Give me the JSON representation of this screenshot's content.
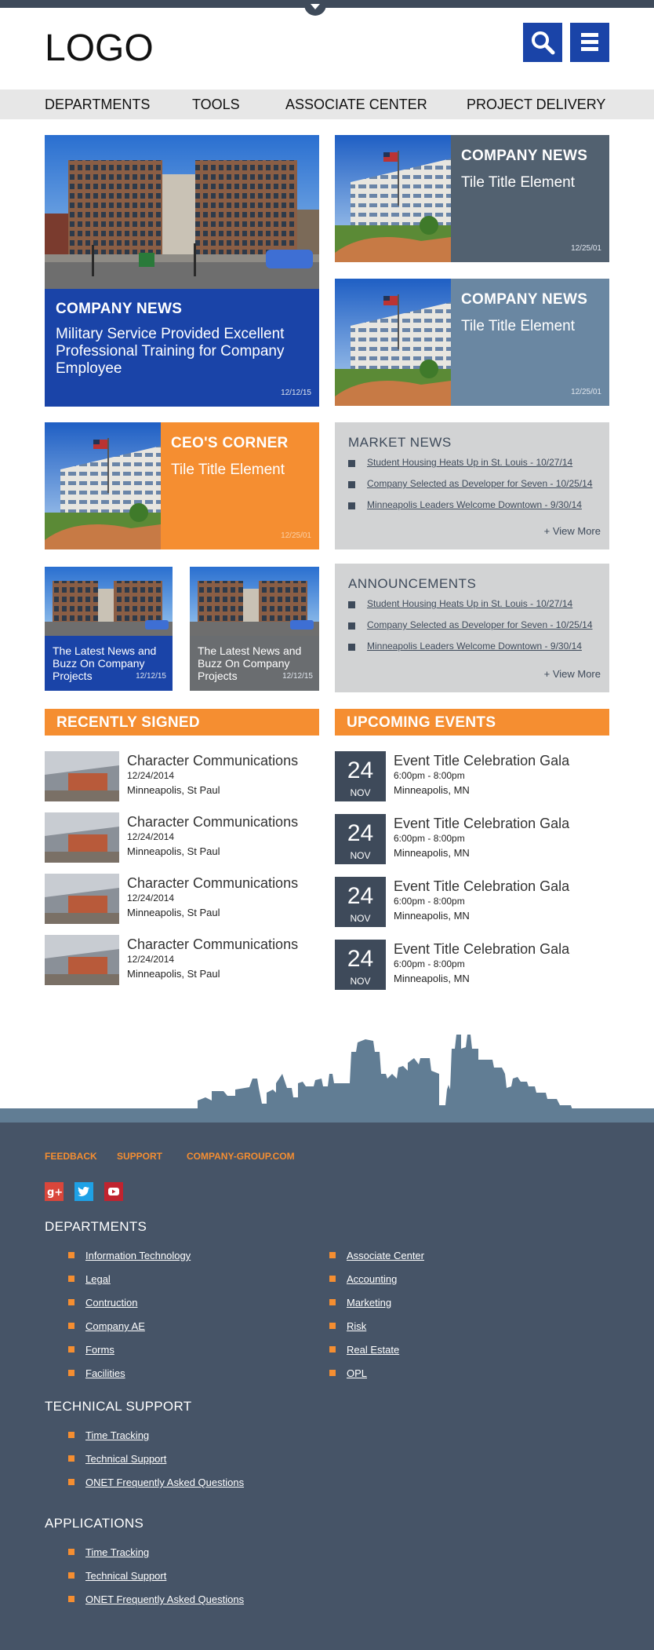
{
  "header": {
    "logo": "LOGO",
    "search_label": "Search",
    "menu_label": "Menu"
  },
  "nav": [
    "DEPARTMENTS",
    "TOOLS",
    "ASSOCIATE CENTER",
    "PROJECT DELIVERY"
  ],
  "hero": {
    "category": "COMPANY NEWS",
    "title": "Military Service Provided Excellent Professional Training for Company Employee",
    "date": "12/12/15"
  },
  "news_tiles": [
    {
      "category": "COMPANY NEWS",
      "title": "Tile Title Element",
      "date": "12/25/01"
    },
    {
      "category": "COMPANY NEWS",
      "title": "Tile Title Element",
      "date": "12/25/01"
    }
  ],
  "ceo_tile": {
    "category": "CEO'S CORNER",
    "title": "Tile Title Element",
    "date": "12/25/01"
  },
  "market_news": {
    "heading": "MARKET NEWS",
    "items": [
      "Student Housing Heats Up in St. Louis - 10/27/14",
      "Company Selected as Developer for Seven - 10/25/14",
      "Minneapolis Leaders Welcome Downtown - 9/30/14"
    ],
    "view_more": "+  View More"
  },
  "small_tiles": [
    {
      "title": "The Latest News and Buzz On Company Projects",
      "date": "12/12/15"
    },
    {
      "title": "The Latest News and Buzz On Company Projects",
      "date": "12/12/15"
    }
  ],
  "announcements": {
    "heading": "ANNOUNCEMENTS",
    "items": [
      "Student Housing Heats Up in St. Louis - 10/27/14",
      "Company Selected as Developer for Seven - 10/25/14",
      "Minneapolis Leaders Welcome Downtown - 9/30/14"
    ],
    "view_more": "+  View More"
  },
  "recently_signed": {
    "heading": "RECENTLY SIGNED",
    "items": [
      {
        "name": "Character Communications",
        "date": "12/24/2014",
        "location": "Minneapolis, St Paul"
      },
      {
        "name": "Character Communications",
        "date": "12/24/2014",
        "location": "Minneapolis, St Paul"
      },
      {
        "name": "Character Communications",
        "date": "12/24/2014",
        "location": "Minneapolis, St Paul"
      },
      {
        "name": "Character Communications",
        "date": "12/24/2014",
        "location": "Minneapolis, St Paul"
      }
    ]
  },
  "upcoming_events": {
    "heading": "UPCOMING EVENTS",
    "items": [
      {
        "day": "24",
        "month": "NOV",
        "title": "Event Title Celebration Gala",
        "time": "6:00pm - 8:00pm",
        "location": "Minneapolis, MN"
      },
      {
        "day": "24",
        "month": "NOV",
        "title": "Event Title Celebration Gala",
        "time": "6:00pm - 8:00pm",
        "location": "Minneapolis, MN"
      },
      {
        "day": "24",
        "month": "NOV",
        "title": "Event Title Celebration Gala",
        "time": "6:00pm - 8:00pm",
        "location": "Minneapolis, MN"
      },
      {
        "day": "24",
        "month": "NOV",
        "title": "Event Title Celebration Gala",
        "time": "6:00pm - 8:00pm",
        "location": "Minneapolis, MN"
      }
    ]
  },
  "footer": {
    "links": [
      "FEEDBACK",
      "SUPPORT",
      "COMPANY-GROUP.COM"
    ],
    "social": [
      "google-plus-icon",
      "twitter-icon",
      "youtube-icon"
    ],
    "departments_heading": "DEPARTMENTS",
    "departments_col1": [
      "Information Technology",
      "Legal",
      "Contruction",
      "Company AE",
      "Forms",
      "Facilities"
    ],
    "departments_col2": [
      "Associate Center",
      "Accounting",
      "Marketing",
      "Risk",
      "Real Estate",
      "OPL"
    ],
    "tech_heading": "TECHNICAL SUPPORT",
    "tech_items": [
      "Time Tracking",
      "Technical Support",
      "ONET Frequently Asked Questions"
    ],
    "apps_heading": "APPLICATIONS",
    "apps_items": [
      "Time Tracking",
      "Technical Support",
      "ONET Frequently Asked Questions"
    ]
  },
  "colors": {
    "blue": "#1a44a8",
    "slate": "#526170",
    "steel": "#6a87a2",
    "orange": "#f58e31",
    "dark": "#465467",
    "grey": "#d2d3d4"
  }
}
